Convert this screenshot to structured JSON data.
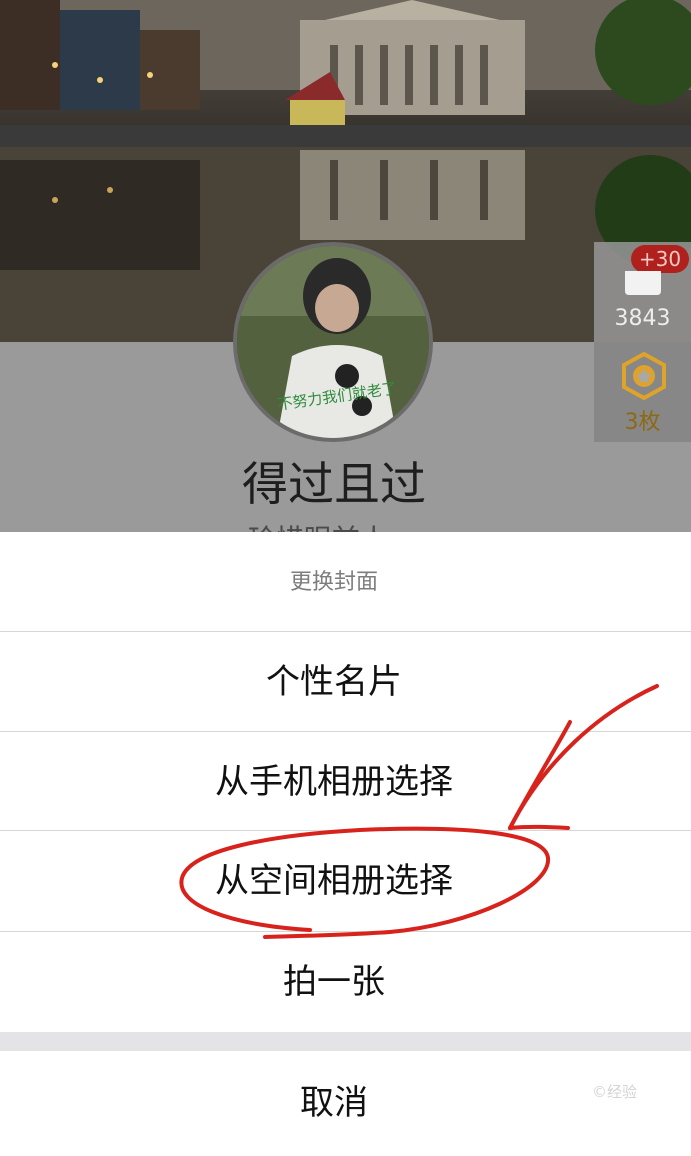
{
  "profile": {
    "username": "得过且过",
    "signature": "珍惜眼前人 ~",
    "stats": {
      "badge": "+30",
      "count": "3843",
      "coins": "3枚"
    },
    "avatar_caption": "不努力我们就老了"
  },
  "action_sheet": {
    "title": "更换封面",
    "items": [
      {
        "label": "个性名片"
      },
      {
        "label": "从手机相册选择"
      },
      {
        "label": "从空间相册选择"
      },
      {
        "label": "拍一张"
      }
    ],
    "cancel": "取消"
  },
  "watermark": "©经验",
  "colors": {
    "annotation": "#d8221c",
    "badge": "#b0201c",
    "coin": "#e0a32a"
  }
}
